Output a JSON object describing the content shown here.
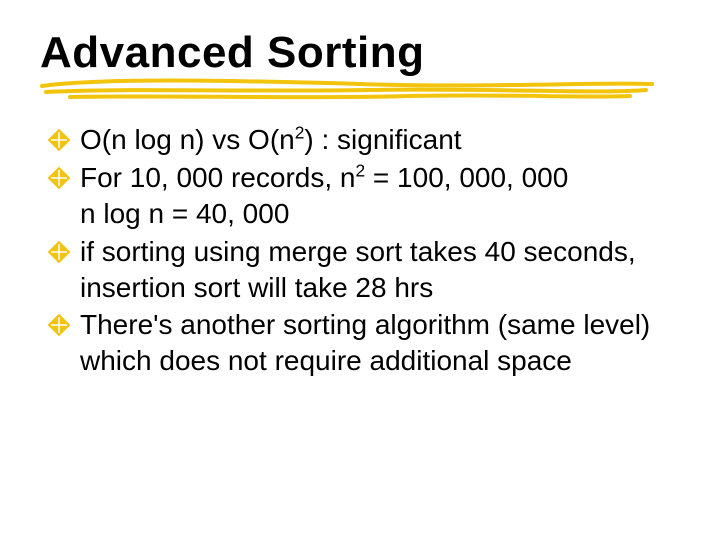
{
  "title": "Advanced Sorting",
  "bullets": [
    {
      "segments": [
        {
          "t": "O(n log n) vs O(n"
        },
        {
          "t": "2",
          "sup": true
        },
        {
          "t": ") : significant"
        }
      ]
    },
    {
      "segments": [
        {
          "t": "For 10, 000 records, n"
        },
        {
          "t": "2",
          "sup": true
        },
        {
          "t": " = 100, 000, 000"
        }
      ],
      "continuation": "n log n = 40, 000"
    },
    {
      "segments": [
        {
          "t": "if sorting using merge sort takes 40 seconds, insertion sort will take 28 hrs"
        }
      ]
    },
    {
      "segments": [
        {
          "t": "There's another sorting algorithm (same level) which does not require additional space"
        }
      ]
    }
  ],
  "colors": {
    "underline": "#f2c40e",
    "marker": "#f2c40e"
  }
}
